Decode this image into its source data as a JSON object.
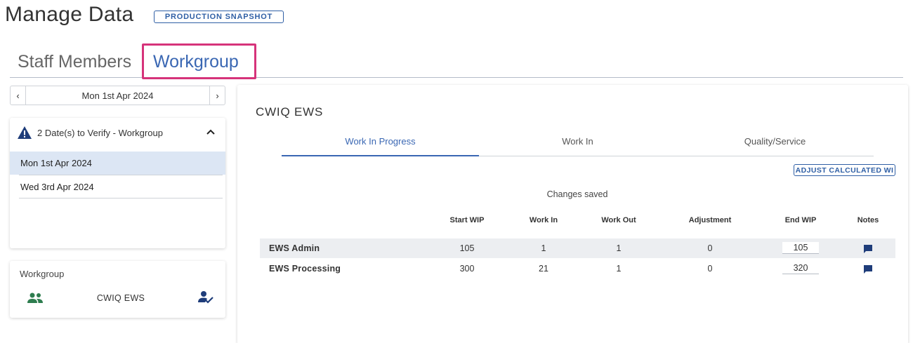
{
  "header": {
    "title": "Manage Data",
    "badge": "PRODUCTION SNAPSHOT"
  },
  "main_tabs": [
    {
      "label": "Staff Members",
      "active": false
    },
    {
      "label": "Workgroup",
      "active": true
    }
  ],
  "colors": {
    "accent": "#3a67b3",
    "highlight": "#d6337a",
    "selected_row": "#dce6f4",
    "warning_icon": "#1f3d7a",
    "people_icon": "#2e7d4f"
  },
  "date_nav": {
    "current_date": "Mon 1st Apr 2024",
    "prev_symbol": "‹",
    "next_symbol": "›"
  },
  "verify_panel": {
    "title": "2 Date(s) to Verify - Workgroup",
    "icon": "warning-icon",
    "dates": [
      "Mon 1st Apr 2024",
      "Wed 3rd Apr 2024"
    ]
  },
  "workgroup_panel": {
    "label": "Workgroup",
    "name": "CWIQ EWS"
  },
  "content": {
    "title": "CWIQ EWS",
    "tabs": [
      "Work In Progress",
      "Work In",
      "Quality/Service"
    ],
    "adjust_button": "ADJUST CALCULATED WI",
    "status": "Changes saved",
    "columns": [
      "Start WIP",
      "Work In",
      "Work Out",
      "Adjustment",
      "End WIP",
      "Notes"
    ],
    "rows": [
      {
        "name": "EWS Admin",
        "start_wip": "105",
        "work_in": "1",
        "work_out": "1",
        "adjustment": "0",
        "end_wip": "105"
      },
      {
        "name": "EWS Processing",
        "start_wip": "300",
        "work_in": "21",
        "work_out": "1",
        "adjustment": "0",
        "end_wip": "320"
      }
    ]
  }
}
